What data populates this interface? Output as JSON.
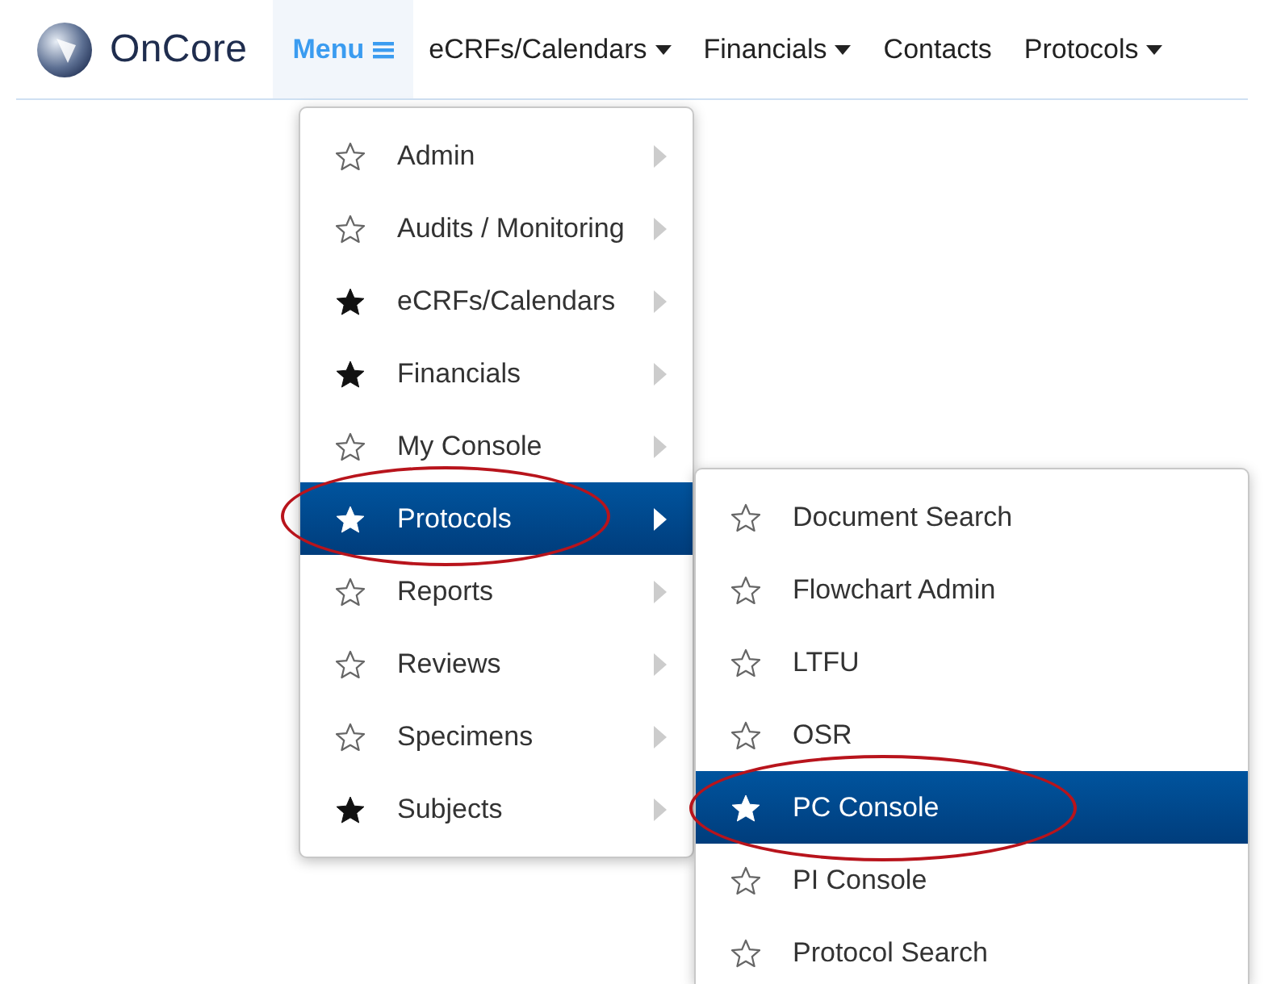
{
  "logo": {
    "text": "OnCore"
  },
  "nav": [
    {
      "label": "Menu",
      "kind": "menu",
      "selected": true
    },
    {
      "label": "eCRFs/Calendars",
      "kind": "dropdown",
      "selected": false
    },
    {
      "label": "Financials",
      "kind": "dropdown",
      "selected": false
    },
    {
      "label": "Contacts",
      "kind": "link",
      "selected": false
    },
    {
      "label": "Protocols",
      "kind": "dropdown",
      "selected": false
    }
  ],
  "menu": {
    "items": [
      {
        "label": "Admin",
        "starred": false,
        "selected": false,
        "circled": false
      },
      {
        "label": "Audits / Monitoring",
        "starred": false,
        "selected": false,
        "circled": false
      },
      {
        "label": "eCRFs/Calendars",
        "starred": true,
        "selected": false,
        "circled": false
      },
      {
        "label": "Financials",
        "starred": true,
        "selected": false,
        "circled": false
      },
      {
        "label": "My Console",
        "starred": false,
        "selected": false,
        "circled": false
      },
      {
        "label": "Protocols",
        "starred": true,
        "selected": true,
        "circled": true
      },
      {
        "label": "Reports",
        "starred": false,
        "selected": false,
        "circled": false
      },
      {
        "label": "Reviews",
        "starred": false,
        "selected": false,
        "circled": false
      },
      {
        "label": "Specimens",
        "starred": false,
        "selected": false,
        "circled": false
      },
      {
        "label": "Subjects",
        "starred": true,
        "selected": false,
        "circled": false
      }
    ]
  },
  "submenu": {
    "items": [
      {
        "label": "Document Search",
        "starred": false,
        "selected": false,
        "circled": false
      },
      {
        "label": "Flowchart Admin",
        "starred": false,
        "selected": false,
        "circled": false
      },
      {
        "label": "LTFU",
        "starred": false,
        "selected": false,
        "circled": false
      },
      {
        "label": "OSR",
        "starred": false,
        "selected": false,
        "circled": false
      },
      {
        "label": "PC Console",
        "starred": true,
        "selected": true,
        "circled": true
      },
      {
        "label": "PI Console",
        "starred": false,
        "selected": false,
        "circled": false
      },
      {
        "label": "Protocol Search",
        "starred": false,
        "selected": false,
        "circled": false
      }
    ]
  }
}
